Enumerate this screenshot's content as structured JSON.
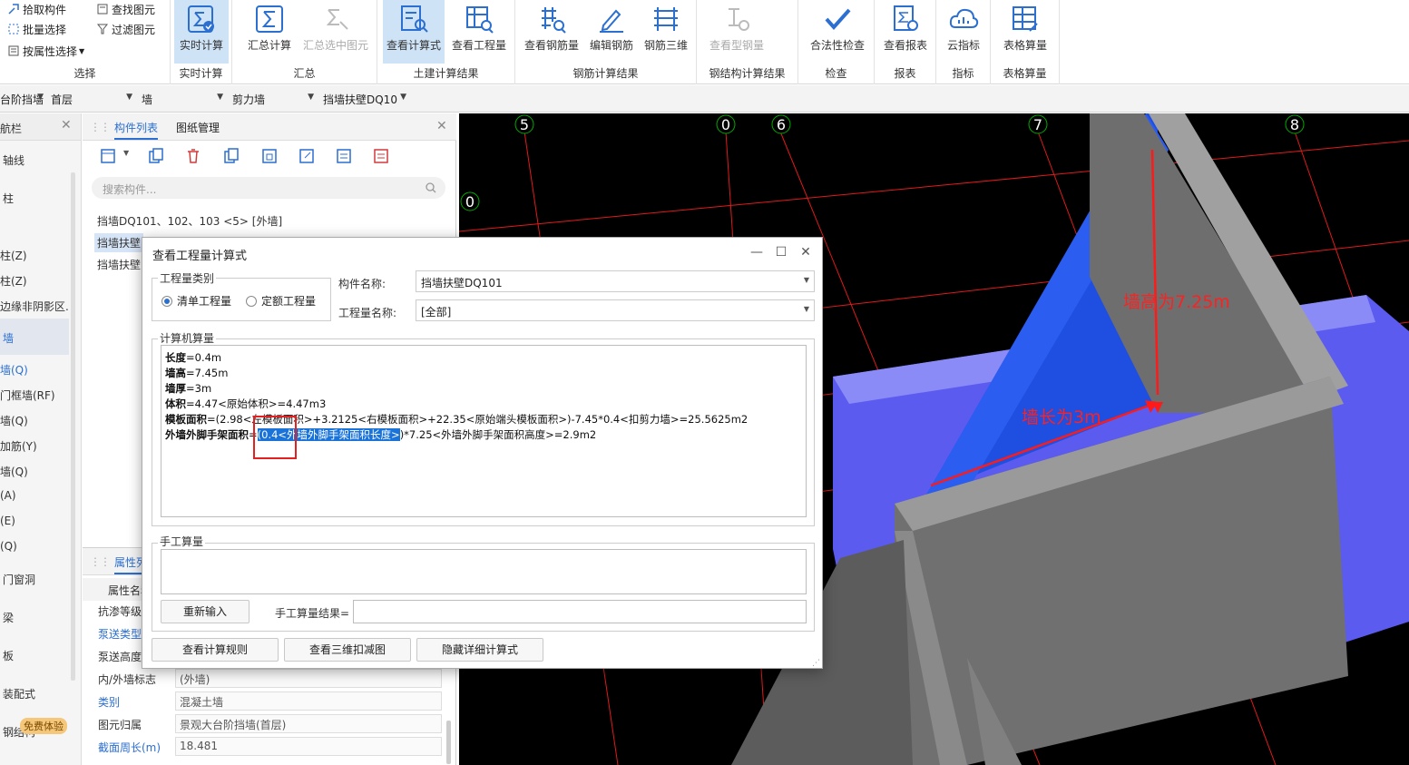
{
  "ribbon": {
    "select_group": {
      "pick": "拾取构件",
      "batch": "批量选择",
      "by_attr": "按属性选择",
      "find": "查找图元",
      "filter": "过滤图元",
      "label": "选择"
    },
    "groups": [
      {
        "label": "实时计算"
      },
      {
        "label": "汇总"
      },
      {
        "label": "土建计算结果"
      },
      {
        "label": "钢筋计算结果"
      },
      {
        "label": "钢结构计算结果"
      },
      {
        "label": "检查"
      },
      {
        "label": "报表"
      },
      {
        "label": "指标"
      },
      {
        "label": "表格算量"
      }
    ],
    "buttons": [
      {
        "label": "实时计算"
      },
      {
        "label": "汇总计算"
      },
      {
        "label": "汇总选中图元"
      },
      {
        "label": "查看计算式"
      },
      {
        "label": "查看工程量"
      },
      {
        "label": "查看钢筋量"
      },
      {
        "label": "编辑钢筋"
      },
      {
        "label": "钢筋三维"
      },
      {
        "label": "查看型钢量"
      },
      {
        "label": "合法性检查"
      },
      {
        "label": "查看报表"
      },
      {
        "label": "云指标"
      },
      {
        "label": "表格算量"
      }
    ]
  },
  "combos": [
    "台阶挡墙",
    "首层",
    "墙",
    "剪力墙",
    "挡墙扶壁DQ10"
  ],
  "leftnav": {
    "title": "航栏",
    "items": [
      "轴线",
      "柱",
      "柱(Z)",
      "柱(Z)",
      "边缘非阴影区.",
      "墙",
      "墙(Q)",
      "门框墙(RF)",
      "墙(Q)",
      "加筋(Y)",
      "墙(Q)",
      "(A)",
      "(E)",
      "(Q)",
      "门窗洞",
      "梁",
      "板",
      "装配式",
      "钢结构"
    ],
    "badge": "免费体验"
  },
  "comp_panel": {
    "tab_list": "构件列表",
    "tab_drawing": "图纸管理",
    "search_placeholder": "搜索构件...",
    "items": [
      "挡墙DQ101、102、103 <5> [外墙]",
      "挡墙扶壁",
      "挡墙扶壁"
    ]
  },
  "prop_panel": {
    "tab": "属性列表",
    "header_name": "属性名称",
    "rows": [
      {
        "name": "抗渗等级",
        "value": ""
      },
      {
        "name": "泵送类型",
        "value": ""
      },
      {
        "name": "泵送高度",
        "value": ""
      },
      {
        "name": "内/外墙标志",
        "value": "(外墙)"
      },
      {
        "name": "类别",
        "value": "混凝土墙"
      },
      {
        "name": "图元归属",
        "value": "景观大台阶挡墙(首层)"
      },
      {
        "name": "截面周长(m)",
        "value": "18.481"
      }
    ]
  },
  "viewport": {
    "axis_labels": [
      "5",
      "0",
      "6",
      "7",
      "8",
      "0"
    ],
    "annotation_height": "墙高为7.25m",
    "annotation_length": "墙长为3m",
    "colors": {
      "blue_wall": "#1f4fe0",
      "slab": "#5b5bf0",
      "gray": "#6e6e6e",
      "grid": "#e01a1a"
    }
  },
  "dialog": {
    "title": "查看工程量计算式",
    "qty_category_label": "工程量类别",
    "radio_list": "清单工程量",
    "radio_quota": "定额工程量",
    "comp_name_label": "构件名称:",
    "comp_name_value": "挡墙扶壁DQ101",
    "qty_name_label": "工程量名称:",
    "qty_name_value": "[全部]",
    "computer_calc_label": "计算机算量",
    "lines": {
      "length_label": "长度",
      "length_val": "=0.4m",
      "height_label": "墙高",
      "height_val": "=7.45m",
      "thick_label": "墙厚",
      "thick_val": "=3m",
      "volume_label": "体积",
      "volume_val": "=4.47<原始体积>=4.47m3",
      "form_label": "模板面积",
      "form_val": "=(2.98<左模板面积>+3.2125<右模板面积>+22.35<原始端头模板面积>)-7.45*0.4<扣剪力墙>=25.5625m2",
      "scaffold_label": "外墙外脚手架面积",
      "scaffold_pre": "=",
      "scaffold_hl": "(0.4<外墙外脚手架面积长度>",
      "scaffold_post": ")*7.25<外墙外脚手架面积高度>=2.9m2"
    },
    "manual_label": "手工算量",
    "reenter_button": "重新输入",
    "manual_result_label": "手工算量结果=",
    "btn_rules": "查看计算规则",
    "btn_3d": "查看三维扣减图",
    "btn_hide": "隐藏详细计算式"
  }
}
